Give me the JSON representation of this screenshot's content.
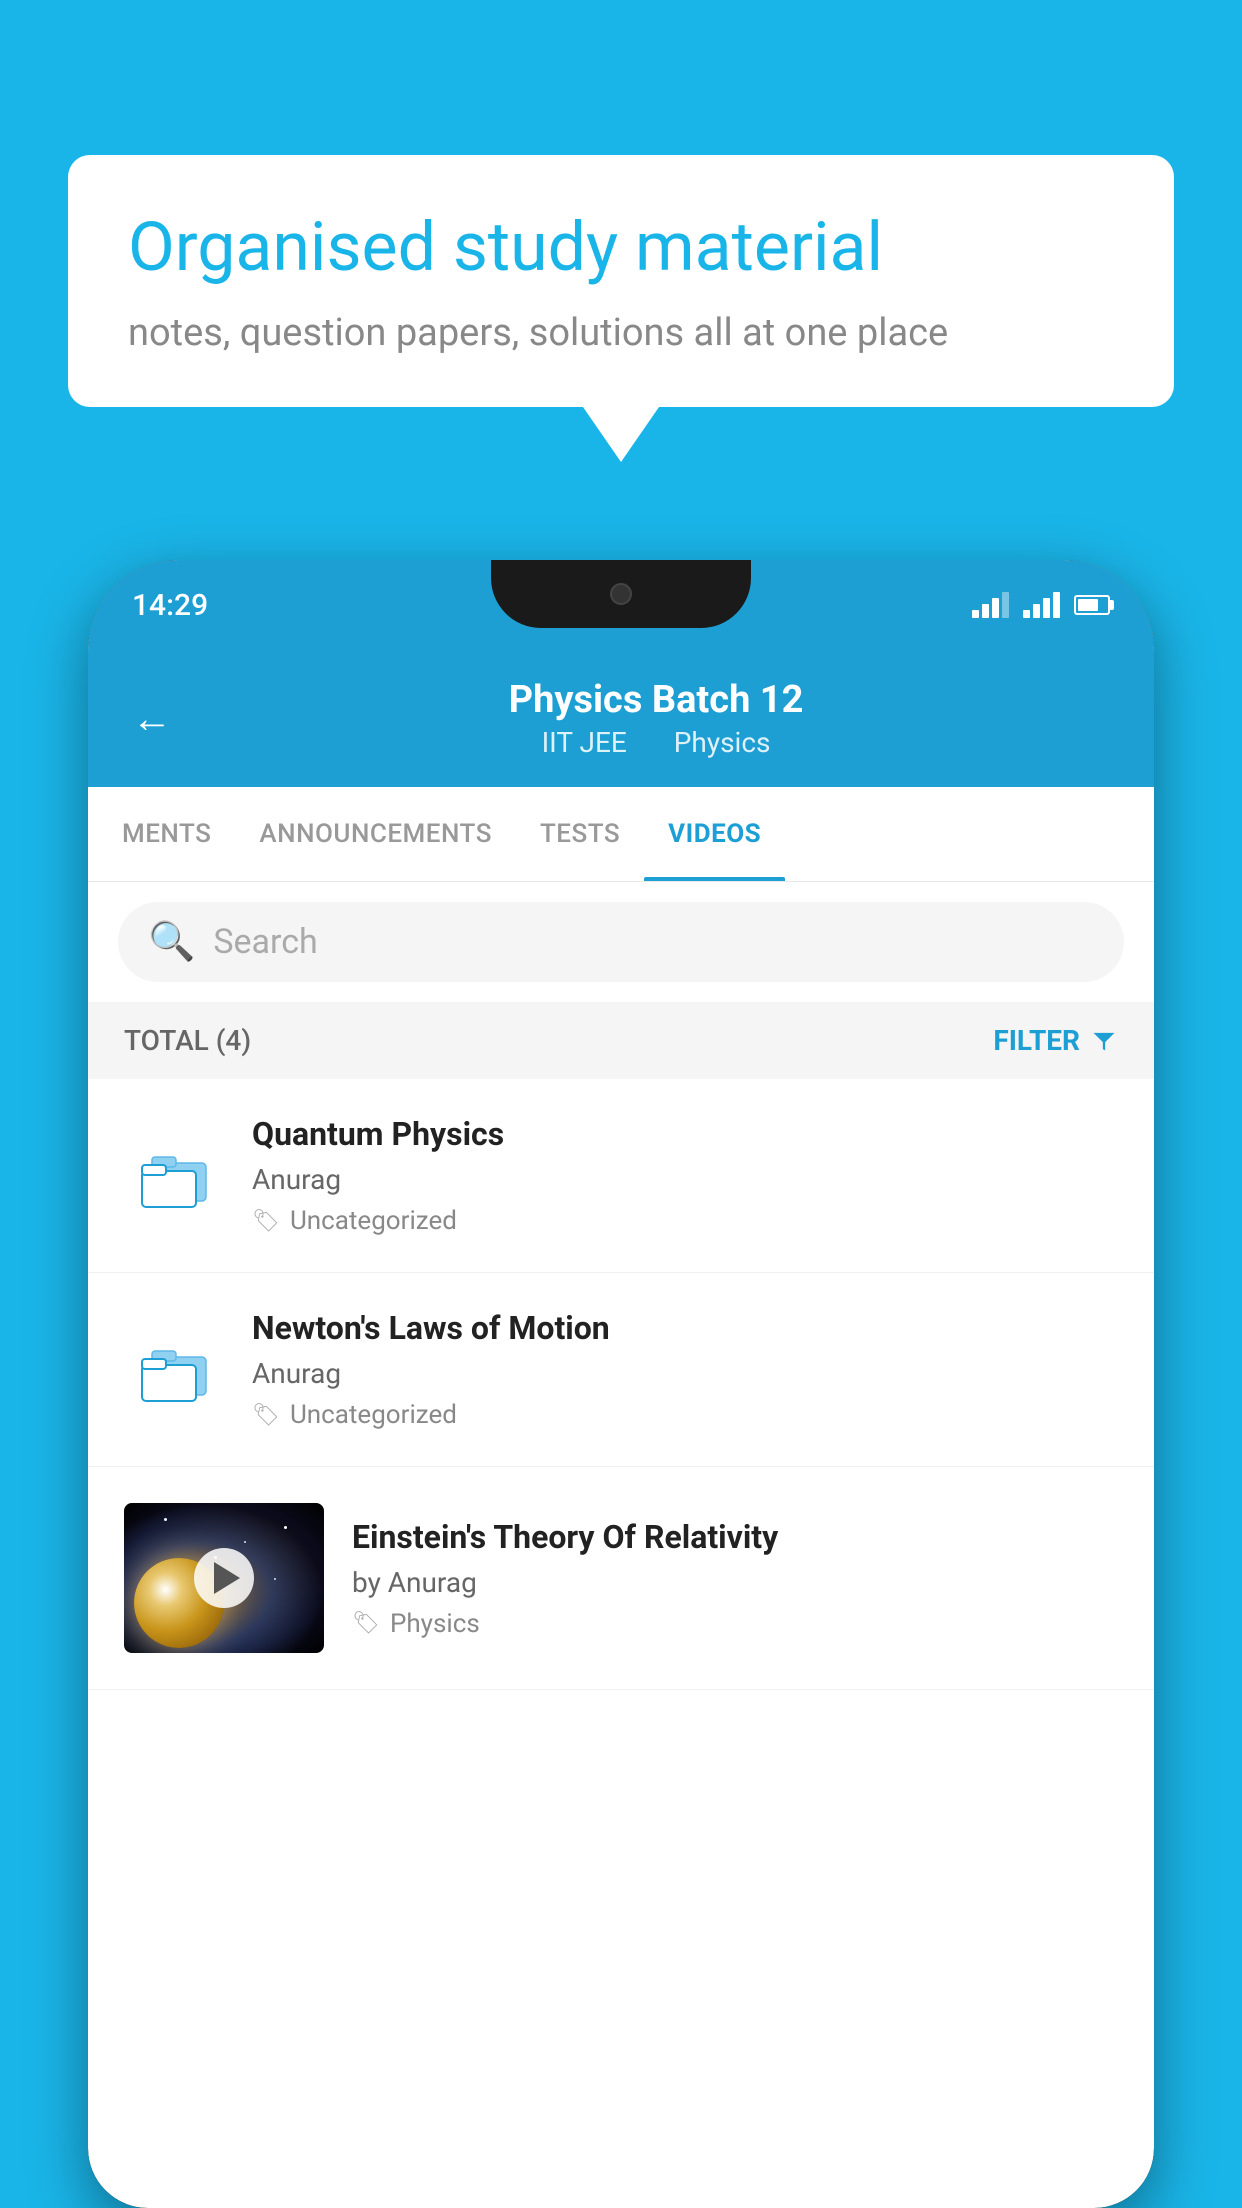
{
  "background_color": "#1ab5e8",
  "speech_bubble": {
    "title": "Organised study material",
    "subtitle": "notes, question papers, solutions all at one place"
  },
  "status_bar": {
    "time": "14:29"
  },
  "app_header": {
    "title": "Physics Batch 12",
    "subtitle_part1": "IIT JEE",
    "subtitle_part2": "Physics"
  },
  "tabs": [
    {
      "label": "MENTS",
      "active": false
    },
    {
      "label": "ANNOUNCEMENTS",
      "active": false
    },
    {
      "label": "TESTS",
      "active": false
    },
    {
      "label": "VIDEOS",
      "active": true
    }
  ],
  "search": {
    "placeholder": "Search"
  },
  "filter_bar": {
    "total_label": "TOTAL (4)",
    "filter_label": "FILTER"
  },
  "videos": [
    {
      "id": 1,
      "title": "Quantum Physics",
      "author": "Anurag",
      "tag": "Uncategorized",
      "has_thumbnail": false
    },
    {
      "id": 2,
      "title": "Newton's Laws of Motion",
      "author": "Anurag",
      "tag": "Uncategorized",
      "has_thumbnail": false
    },
    {
      "id": 3,
      "title": "Einstein's Theory Of Relativity",
      "author": "by Anurag",
      "tag": "Physics",
      "has_thumbnail": true
    }
  ]
}
